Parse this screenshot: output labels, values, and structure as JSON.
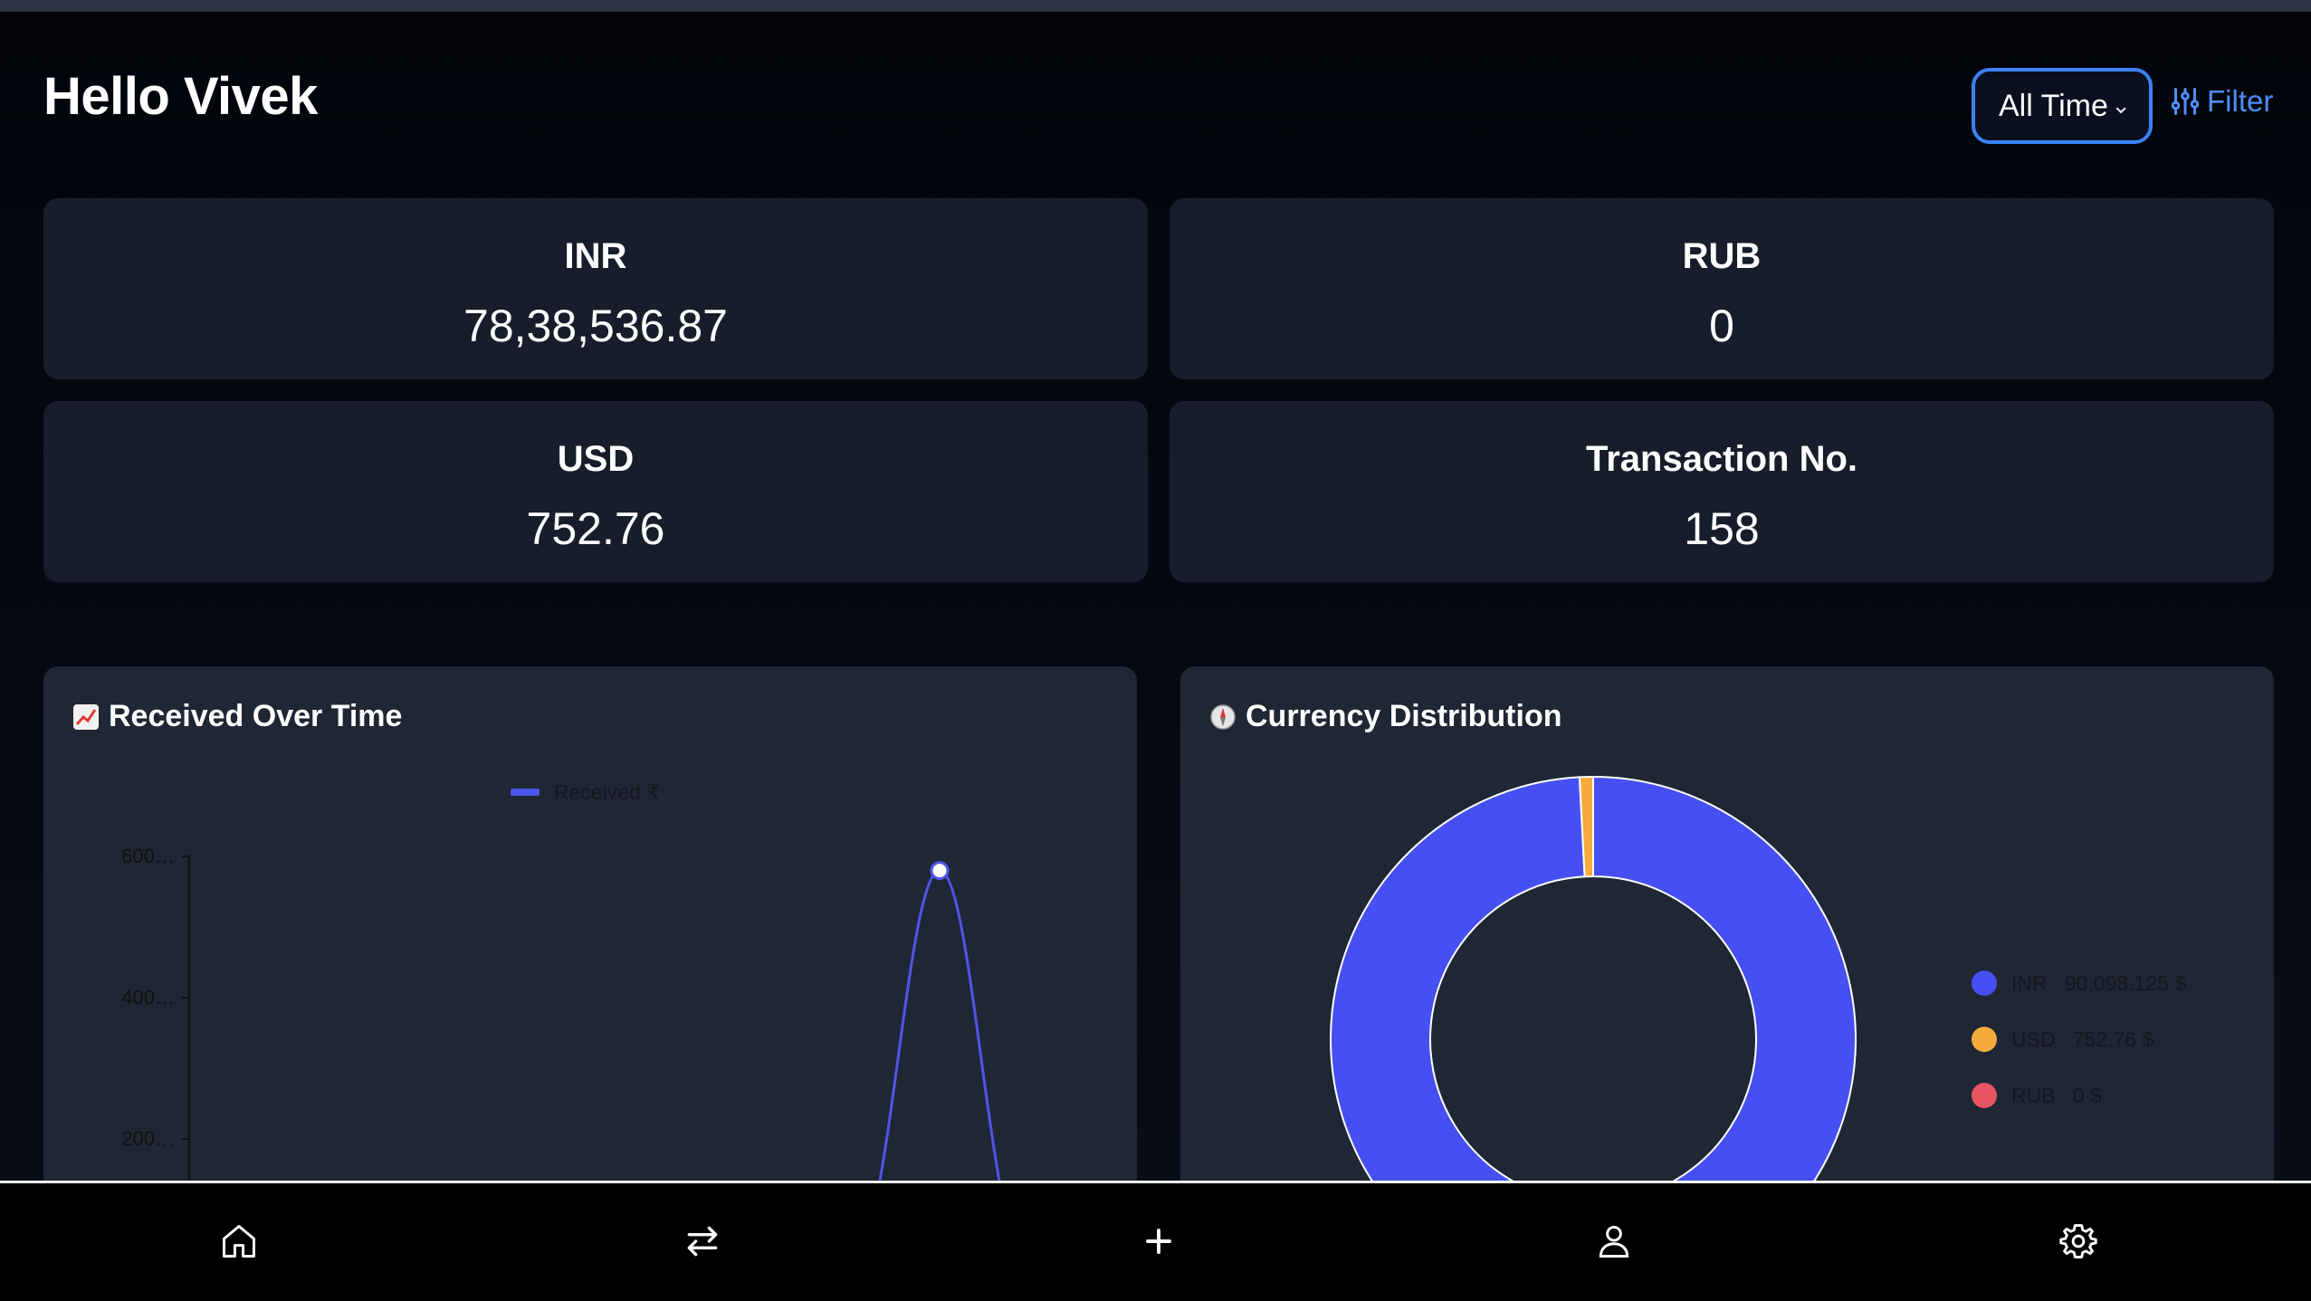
{
  "greeting": "Hello Vivek",
  "range": {
    "selected": "All Time"
  },
  "filter_label": "Filter",
  "stats": [
    {
      "label": "INR",
      "value": "78,38,536.87"
    },
    {
      "label": "RUB",
      "value": "0"
    },
    {
      "label": "USD",
      "value": "752.76"
    },
    {
      "label": "Transaction No.",
      "value": "158"
    }
  ],
  "charts": {
    "received": {
      "title": "Received Over Time",
      "emoji": "chart-increasing-icon"
    },
    "distribution": {
      "title": "Currency Distribution",
      "emoji": "compass-icon"
    }
  },
  "chart_data": [
    {
      "type": "line",
      "title": "Received Over Time",
      "series": [
        {
          "name": "Received ₹",
          "color": "#4f55e8",
          "peak_value": 580
        }
      ],
      "yticks": [
        "600…",
        "400…",
        "200…"
      ],
      "ylim": [
        0,
        600
      ],
      "legend": "top"
    },
    {
      "type": "pie",
      "title": "Currency Distribution",
      "slices": [
        {
          "label": "INR : 90,098.125 $",
          "value": 90098.125,
          "color": "#4650f2"
        },
        {
          "label": "USD : 752.76 $",
          "value": 752.76,
          "color": "#f5ac3d"
        },
        {
          "label": "RUB : 0 $",
          "value": 0,
          "color": "#e85560"
        }
      ],
      "legend": "right"
    }
  ],
  "nav": [
    {
      "name": "home-icon"
    },
    {
      "name": "transfer-icon"
    },
    {
      "name": "add-icon"
    },
    {
      "name": "profile-icon"
    },
    {
      "name": "settings-icon"
    }
  ],
  "colors": {
    "accent": "#3b82f6",
    "card": "#171d2b",
    "panel": "#1f2634"
  }
}
